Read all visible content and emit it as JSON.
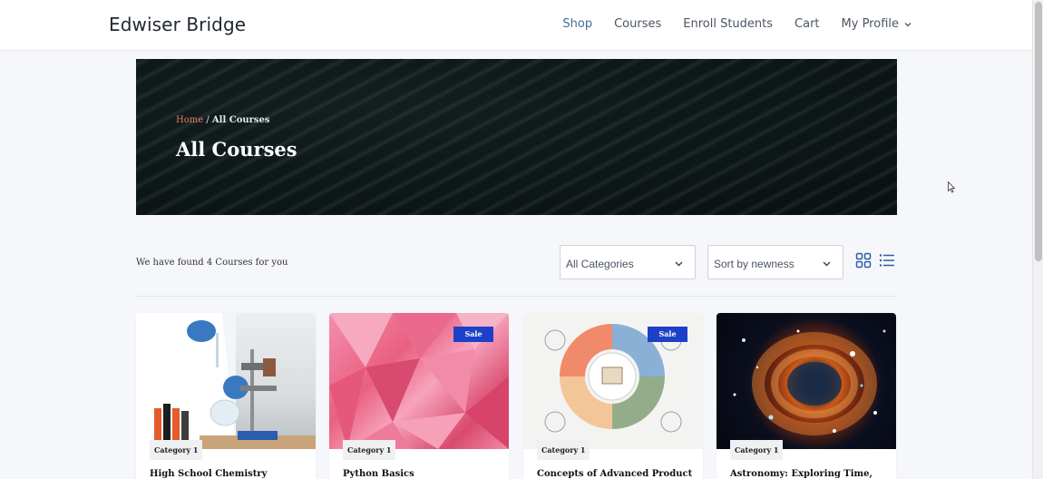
{
  "header": {
    "brand": "Edwiser Bridge",
    "nav": [
      {
        "label": "Shop",
        "active": true
      },
      {
        "label": "Courses"
      },
      {
        "label": "Enroll Students"
      },
      {
        "label": "Cart"
      },
      {
        "label": "My Profile"
      }
    ]
  },
  "hero": {
    "breadcrumb_home": "Home",
    "breadcrumb_sep": " / ",
    "breadcrumb_current": "All Courses",
    "title": "All Courses"
  },
  "toolbar": {
    "found_text": "We have found 4 Courses for you",
    "category_select": "All Categories",
    "sort_select": "Sort by newness"
  },
  "courses": [
    {
      "title": "High School Chemistry",
      "category": "Category 1",
      "sale": null
    },
    {
      "title": "Python Basics",
      "category": "Category 1",
      "sale": "Sale"
    },
    {
      "title": "Concepts of Advanced Product",
      "category": "Category 1",
      "sale": "Sale"
    },
    {
      "title": "Astronomy: Exploring Time,",
      "category": "Category 1",
      "sale": null
    }
  ],
  "colors": {
    "accent": "#3f6d9a",
    "sale_badge": "#1e40c9",
    "breadcrumb_home": "#ea7a5c"
  }
}
